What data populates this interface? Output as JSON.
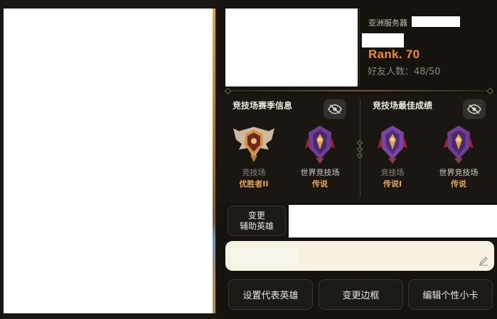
{
  "profile": {
    "server_label": "亚洲服务器",
    "rank": "Rank. 70",
    "friends": "好友人数：48/50"
  },
  "arena_season": {
    "title": "竞技场赛季信息",
    "badges": [
      {
        "label": "竞技场",
        "tier": "优胜者II"
      },
      {
        "label": "世界竞技场",
        "tier": "传说"
      }
    ]
  },
  "arena_best": {
    "title": "竞技场最佳成绩",
    "badges": [
      {
        "label": "竞技场",
        "tier": "传说I"
      },
      {
        "label": "世界竞技场",
        "tier": "传说"
      }
    ]
  },
  "buttons": {
    "support_line1": "变更",
    "support_line2": "辅助英雄",
    "set_hero": "设置代表英雄",
    "change_frame": "变更边框",
    "edit_card": "编辑个性小卡"
  },
  "icons": {
    "eye_toggle": "eye-slash-icon",
    "edit": "pencil-icon"
  },
  "colors": {
    "rank_accent": "#f28a2b",
    "tier_gold": "#e2a551"
  }
}
